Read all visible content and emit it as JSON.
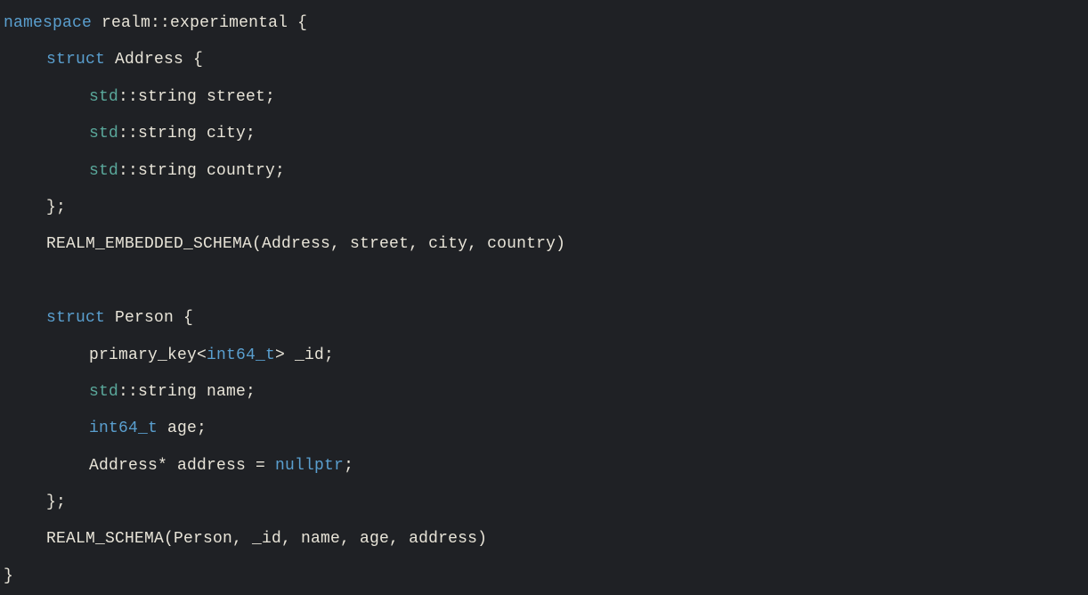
{
  "code": {
    "kw_namespace": "namespace",
    "kw_struct_1": "struct",
    "kw_struct_2": "struct",
    "kw_nullptr": "nullptr",
    "ns_name": "realm::experimental",
    "brace_open_ns": " {",
    "struct_address_name": "Address",
    "brace_open_addr": " {",
    "std_1": "std",
    "string_1": "::string",
    "field_street": " street;",
    "std_2": "std",
    "string_2": "::string",
    "field_city": " city;",
    "std_3": "std",
    "string_3": "::string",
    "field_country": " country;",
    "brace_close_addr": "};",
    "macro_embedded": "REALM_EMBEDDED_SCHEMA(Address, street, city, country)",
    "struct_person_name": "Person",
    "brace_open_person": " {",
    "primary_key_prefix": "primary_key<",
    "int64_1": "int64_t",
    "primary_key_suffix": "> _id;",
    "std_4": "std",
    "string_4": "::string",
    "field_name": " name;",
    "int64_2": "int64_t",
    "field_age": " age;",
    "address_ptr_prefix": "Address* address = ",
    "address_ptr_suffix": ";",
    "brace_close_person": "};",
    "macro_schema": "REALM_SCHEMA(Person, _id, name, age, address)",
    "brace_close_ns": "}"
  }
}
